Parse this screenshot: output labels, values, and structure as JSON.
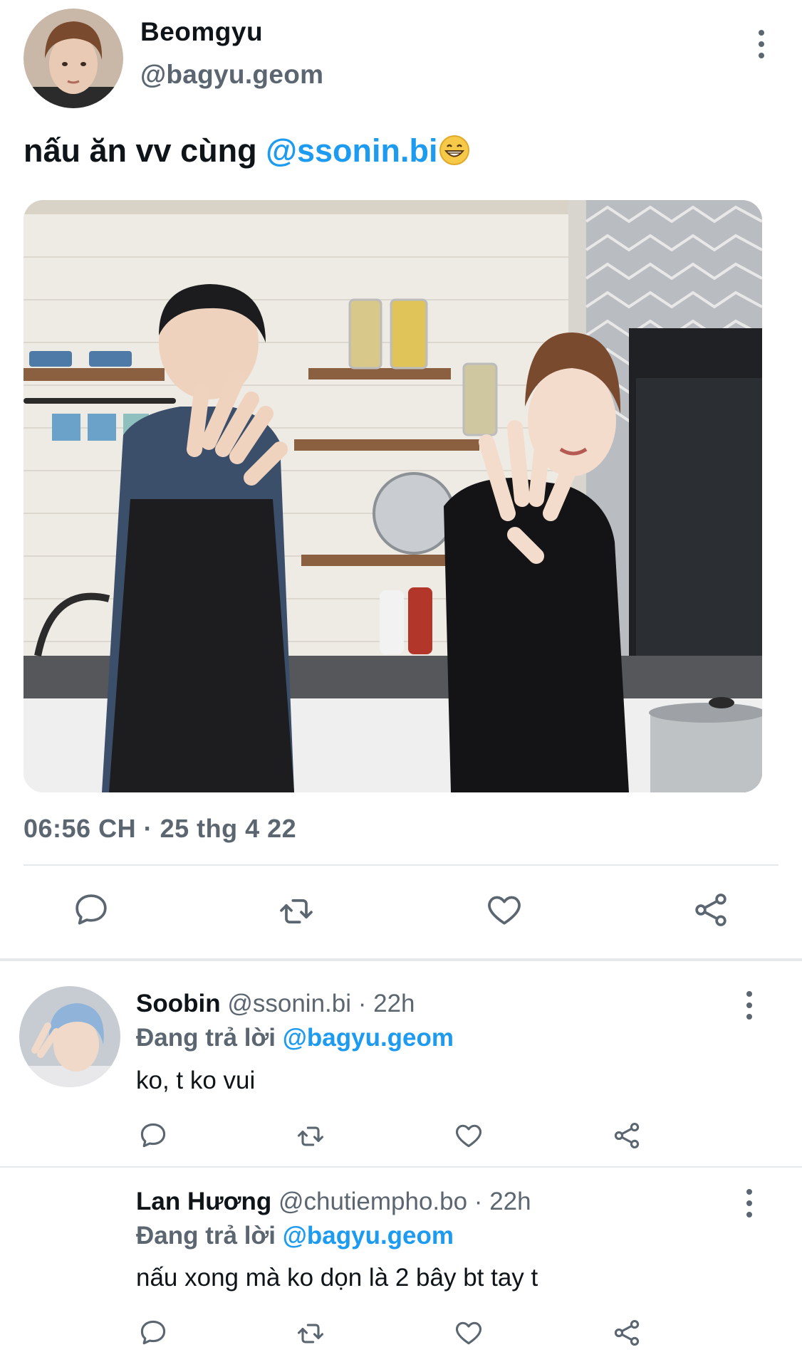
{
  "tweet": {
    "author_name": "Beomgyu",
    "author_handle": "@bagyu.geom",
    "text_prefix": "nấu ăn vv cùng ",
    "text_mention": "@ssonin.bi",
    "emoji": "grinning-face-emoji",
    "timestamp": "06:56 CH · 25 thg 4 22"
  },
  "actions": [
    "reply-icon",
    "retweet-icon",
    "like-icon",
    "share-icon"
  ],
  "replies": [
    {
      "name": "Soobin",
      "meta": "@ssonin.bi · 22h",
      "replying_prefix": "Đang trả lời ",
      "replying_handle": "@bagyu.geom",
      "text": "ko, t ko vui"
    },
    {
      "name": "Lan Hương",
      "meta": "@chutiempho.bo · 22h",
      "replying_prefix": "Đang trả lời ",
      "replying_handle": "@bagyu.geom",
      "text": "nấu xong mà ko dọn là 2 bây bt tay t"
    }
  ],
  "colors": {
    "accent": "#1d9bf0",
    "secondary_text": "#5b6670",
    "divider": "#e6e9ec"
  }
}
